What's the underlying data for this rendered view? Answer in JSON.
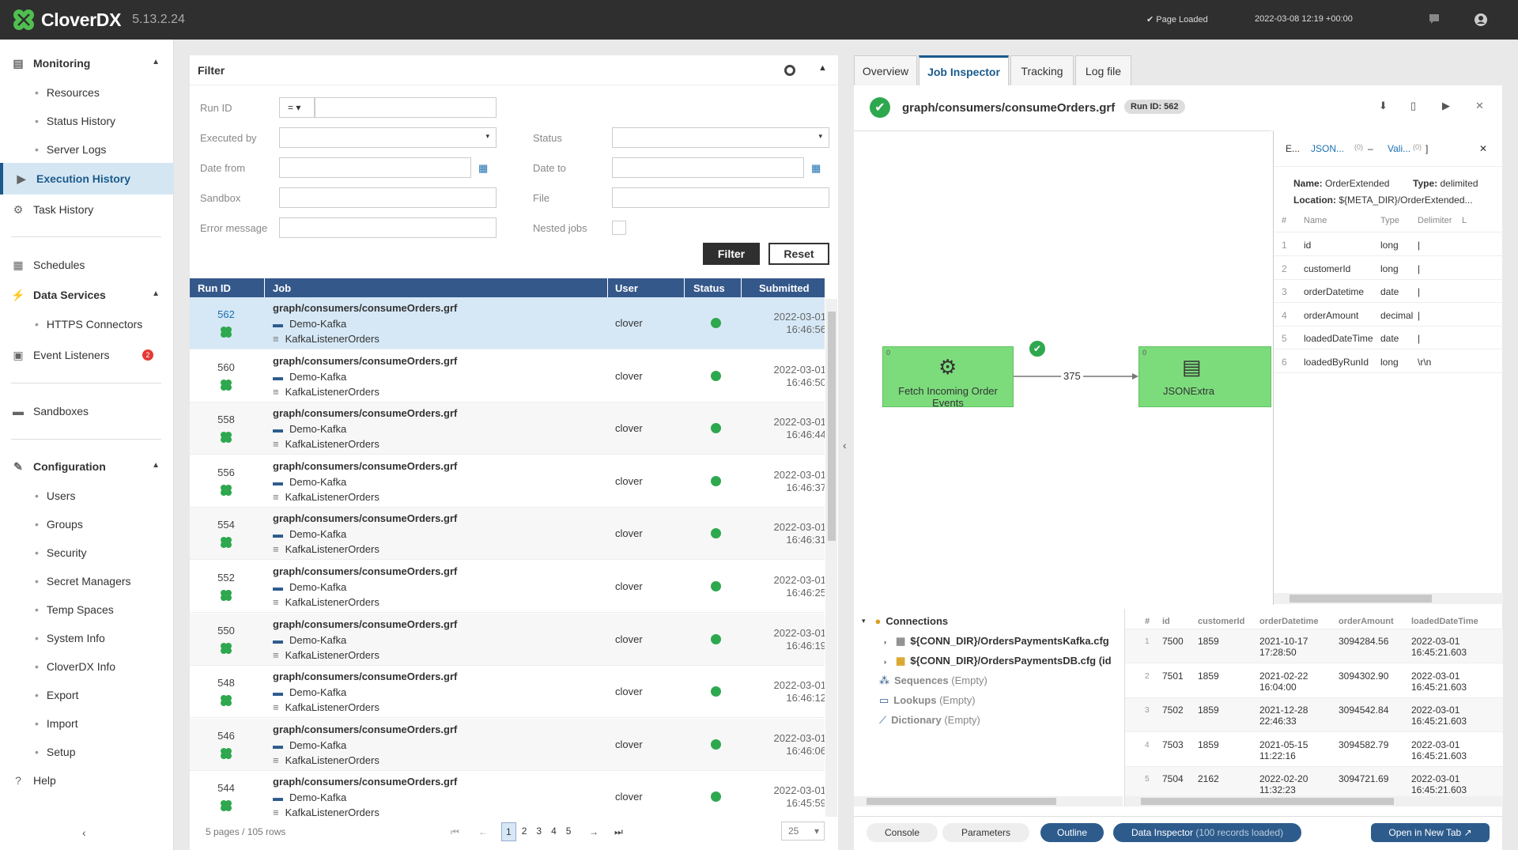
{
  "app": {
    "name": "CloverDX",
    "version": "5.13.2.24",
    "status": "Page Loaded",
    "datetime": "2022-03-08 12:19 +00:00"
  },
  "sidebar": {
    "monitoring": "Monitoring",
    "resources": "Resources",
    "status_history": "Status History",
    "server_logs": "Server Logs",
    "execution_history": "Execution History",
    "task_history": "Task History",
    "schedules": "Schedules",
    "data_services": "Data Services",
    "https_connectors": "HTTPS Connectors",
    "event_listeners": "Event Listeners",
    "event_badge": "2",
    "sandboxes": "Sandboxes",
    "configuration": "Configuration",
    "users": "Users",
    "groups": "Groups",
    "security": "Security",
    "secret_managers": "Secret Managers",
    "temp_spaces": "Temp Spaces",
    "system_info": "System Info",
    "cloverdx_info": "CloverDX Info",
    "export": "Export",
    "import": "Import",
    "setup": "Setup",
    "help": "Help"
  },
  "filter": {
    "title": "Filter",
    "run_id": "Run ID",
    "run_op": "=",
    "executed_by": "Executed by",
    "status": "Status",
    "date_from": "Date from",
    "date_to": "Date to",
    "sandbox": "Sandbox",
    "file": "File",
    "error_message": "Error message",
    "nested_jobs": "Nested jobs",
    "filter_btn": "Filter",
    "reset_btn": "Reset"
  },
  "table": {
    "headers": [
      "Run ID",
      "Job",
      "User",
      "Status",
      "Submitted"
    ],
    "rows": [
      {
        "id": "562",
        "job": "graph/consumers/consumeOrders.grf",
        "sandbox": "Demo-Kafka",
        "listener": "KafkaListenerOrders",
        "user": "clover",
        "date": "2022-03-01",
        "time": "16:46:56"
      },
      {
        "id": "560",
        "job": "graph/consumers/consumeOrders.grf",
        "sandbox": "Demo-Kafka",
        "listener": "KafkaListenerOrders",
        "user": "clover",
        "date": "2022-03-01",
        "time": "16:46:50"
      },
      {
        "id": "558",
        "job": "graph/consumers/consumeOrders.grf",
        "sandbox": "Demo-Kafka",
        "listener": "KafkaListenerOrders",
        "user": "clover",
        "date": "2022-03-01",
        "time": "16:46:44"
      },
      {
        "id": "556",
        "job": "graph/consumers/consumeOrders.grf",
        "sandbox": "Demo-Kafka",
        "listener": "KafkaListenerOrders",
        "user": "clover",
        "date": "2022-03-01",
        "time": "16:46:37"
      },
      {
        "id": "554",
        "job": "graph/consumers/consumeOrders.grf",
        "sandbox": "Demo-Kafka",
        "listener": "KafkaListenerOrders",
        "user": "clover",
        "date": "2022-03-01",
        "time": "16:46:31"
      },
      {
        "id": "552",
        "job": "graph/consumers/consumeOrders.grf",
        "sandbox": "Demo-Kafka",
        "listener": "KafkaListenerOrders",
        "user": "clover",
        "date": "2022-03-01",
        "time": "16:46:25"
      },
      {
        "id": "550",
        "job": "graph/consumers/consumeOrders.grf",
        "sandbox": "Demo-Kafka",
        "listener": "KafkaListenerOrders",
        "user": "clover",
        "date": "2022-03-01",
        "time": "16:46:19"
      },
      {
        "id": "548",
        "job": "graph/consumers/consumeOrders.grf",
        "sandbox": "Demo-Kafka",
        "listener": "KafkaListenerOrders",
        "user": "clover",
        "date": "2022-03-01",
        "time": "16:46:12"
      },
      {
        "id": "546",
        "job": "graph/consumers/consumeOrders.grf",
        "sandbox": "Demo-Kafka",
        "listener": "KafkaListenerOrders",
        "user": "clover",
        "date": "2022-03-01",
        "time": "16:46:06"
      },
      {
        "id": "544",
        "job": "graph/consumers/consumeOrders.grf",
        "sandbox": "Demo-Kafka",
        "listener": "KafkaListenerOrders",
        "user": "clover",
        "date": "2022-03-01",
        "time": "16:45:59"
      }
    ]
  },
  "pager": {
    "summary": "5 pages / 105 rows",
    "pages": [
      "1",
      "2",
      "3",
      "4",
      "5"
    ],
    "page_size": "25"
  },
  "inspector": {
    "tabs": [
      "Overview",
      "Job Inspector",
      "Tracking",
      "Log file"
    ],
    "job": "graph/consumers/consumeOrders.grf",
    "run_badge": "Run ID: 562",
    "node1": "Fetch Incoming Order Events",
    "node1_port": "0",
    "node2": "JSONExtra",
    "node2_port": "0",
    "edge_count": "375",
    "meta_head": {
      "e": "E...",
      "json": "JSON...",
      "n1": "(0)",
      "dash": "–",
      "vali": "Vali...",
      "n2": "(0)",
      "bracket": "]"
    },
    "meta_name_label": "Name:",
    "meta_name": "OrderExtended",
    "meta_type_label": "Type:",
    "meta_type": "delimited",
    "meta_loc_label": "Location:",
    "meta_loc": "${META_DIR}/OrderExtended...",
    "meta_headers": [
      "#",
      "Name",
      "Type",
      "Delimiter",
      "L"
    ],
    "meta_rows": [
      {
        "n": "1",
        "name": "id",
        "type": "long",
        "delim": "|"
      },
      {
        "n": "2",
        "name": "customerId",
        "type": "long",
        "delim": "|"
      },
      {
        "n": "3",
        "name": "orderDatetime",
        "type": "date",
        "delim": "|"
      },
      {
        "n": "4",
        "name": "orderAmount",
        "type": "decimal",
        "delim": "|"
      },
      {
        "n": "5",
        "name": "loadedDateTime",
        "type": "date",
        "delim": "|"
      },
      {
        "n": "6",
        "name": "loadedByRunId",
        "type": "long",
        "delim": "\\r\\n"
      }
    ],
    "outline": {
      "connections": "Connections",
      "conn1": "${CONN_DIR}/OrdersPaymentsKafka.cfg",
      "conn2": "${CONN_DIR}/OrdersPaymentsDB.cfg (id",
      "sequences": "Sequences",
      "lookups": "Lookups",
      "dictionary": "Dictionary",
      "empty": "(Empty)"
    },
    "data_headers": [
      "#",
      "id",
      "customerId",
      "orderDatetime",
      "orderAmount",
      "loadedDateTime"
    ],
    "data_rows": [
      {
        "n": "1",
        "id": "7500",
        "cust": "1859",
        "d1": "2021-10-17",
        "t1": "17:28:50",
        "amt": "3094284.56",
        "d2": "2022-03-01",
        "t2": "16:45:21.603"
      },
      {
        "n": "2",
        "id": "7501",
        "cust": "1859",
        "d1": "2021-02-22",
        "t1": "16:04:00",
        "amt": "3094302.90",
        "d2": "2022-03-01",
        "t2": "16:45:21.603"
      },
      {
        "n": "3",
        "id": "7502",
        "cust": "1859",
        "d1": "2021-12-28",
        "t1": "22:46:33",
        "amt": "3094542.84",
        "d2": "2022-03-01",
        "t2": "16:45:21.603"
      },
      {
        "n": "4",
        "id": "7503",
        "cust": "1859",
        "d1": "2021-05-15",
        "t1": "11:22:16",
        "amt": "3094582.79",
        "d2": "2022-03-01",
        "t2": "16:45:21.603"
      },
      {
        "n": "5",
        "id": "7504",
        "cust": "2162",
        "d1": "2022-02-20",
        "t1": "11:32:23",
        "amt": "3094721.69",
        "d2": "2022-03-01",
        "t2": "16:45:21.603"
      }
    ],
    "bottom": {
      "console": "Console",
      "parameters": "Parameters",
      "outline": "Outline",
      "data_inspector": "Data Inspector",
      "loaded": "(100 records loaded)",
      "new_tab": "Open in New Tab"
    }
  }
}
